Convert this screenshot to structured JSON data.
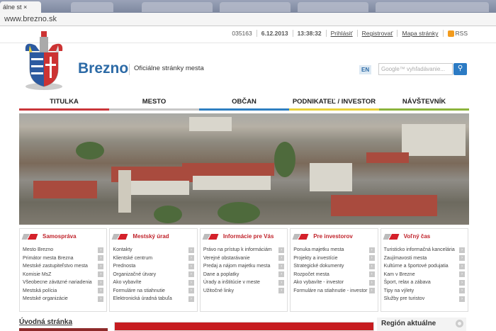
{
  "browser": {
    "tab_title": "álne st",
    "tab_close": "×",
    "url": "www.brezno.sk"
  },
  "topbar": {
    "counter": "035163",
    "date": "6.12.2013",
    "time": "13:38:32",
    "login": "Prihlásiť",
    "register": "Registrovať",
    "sitemap": "Mapa stránky",
    "rss": "RSS"
  },
  "header": {
    "brand": "Brezno",
    "tagline": "Oficiálne stránky mesta",
    "lang": "EN",
    "search_placeholder": "Google™ vyhľadávanie...",
    "search_icon": "magnifier-icon"
  },
  "nav": [
    {
      "label": "TITULKA",
      "color": "#c9363a"
    },
    {
      "label": "MESTO",
      "color": "#c8c8c8"
    },
    {
      "label": "OBČAN",
      "color": "#2f7fc1"
    },
    {
      "label": "PODNIKATEĽ / INVESTOR",
      "color": "#e8d23a"
    },
    {
      "label": "NÁVŠTEVNÍK",
      "color": "#8cb43c"
    }
  ],
  "boxes": [
    {
      "title": "Samospráva",
      "items": [
        "Mesto Brezno",
        "Primátor mesta Brezna",
        "Mestské zastupiteľstvo mesta",
        "Komisie MsZ",
        "Všeobecne záväzné nariadenia",
        "Mestská polícia",
        "Mestské organizácie"
      ]
    },
    {
      "title": "Mestský úrad",
      "items": [
        "Kontakty",
        "Klientské centrum",
        "Prednosta",
        "Organizačné útvary",
        "Ako vybavíte",
        "Formuláre na stiahnutie",
        "Elektronická úradná tabuľa"
      ]
    },
    {
      "title": "Informácie pre Vás",
      "items": [
        "Právo na prístup k informáciám",
        "Verejné obstarávanie",
        "Predaj a nájom majetku mesta",
        "Dane a poplatky",
        "Úrady a inštitúcie v meste",
        "Užitočné linky"
      ]
    },
    {
      "title": "Pre investorov",
      "items": [
        "Ponuka majetku mesta",
        "Projekty a investície",
        "Strategické dokumenty",
        "Rozpočet mesta",
        "Ako vybavíte - investor",
        "Formuláre na stiahnutie - investor"
      ]
    },
    {
      "title": "Voľný čas",
      "items": [
        "Turisticko informačná kancelária",
        "Zaujímavosti mesta",
        "Kultúrne a športové podujatia",
        "Kam v Brezne",
        "Šport, relax a zábava",
        "Tipy na výlety",
        "Služby pre turistov"
      ]
    }
  ],
  "bottom": {
    "intro": "Úvodná stránka",
    "region": "Región aktuálne"
  }
}
